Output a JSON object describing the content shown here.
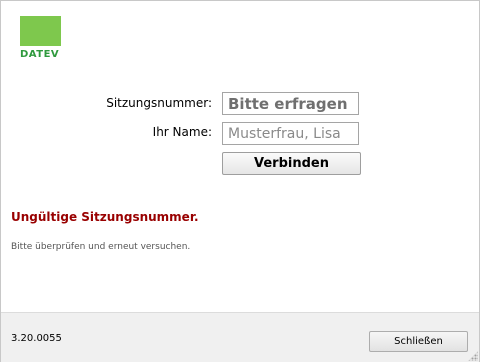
{
  "brand": {
    "logo_text": "DATEV",
    "logo_color": "#7ec84d",
    "logo_text_color": "#2f9a3e"
  },
  "form": {
    "session_label": "Sitzungsnummer:",
    "session_placeholder": "Bitte erfragen",
    "name_label": "Ihr Name:",
    "name_placeholder": "Musterfrau, Lisa",
    "connect_label": "Verbinden"
  },
  "error": {
    "title": "Ungültige Sitzungsnummer.",
    "detail": "Bitte überprüfen und erneut versuchen.",
    "color": "#990000"
  },
  "footer": {
    "version": "3.20.0055",
    "close_label": "Schließen"
  }
}
